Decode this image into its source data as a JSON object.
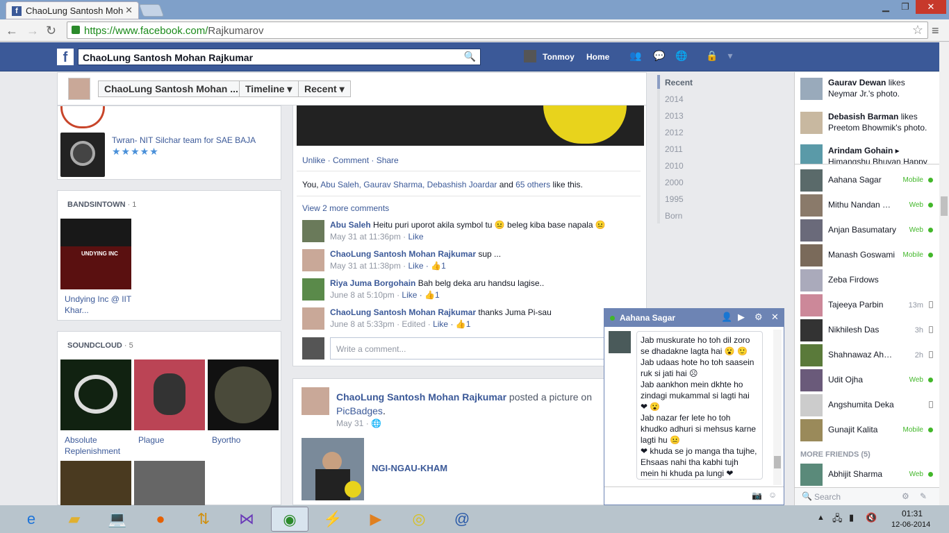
{
  "browser": {
    "tab_title": "ChaoLung Santosh Mohan",
    "url_host": "https://www.facebook.com/",
    "url_path": "Rajkumarov"
  },
  "fb": {
    "search_value": "ChaoLung Santosh Mohan Rajkumar",
    "user_name": "Tonmoy",
    "home_label": "Home"
  },
  "sticky": {
    "name_btn": "ChaoLung Santosh Mohan ...",
    "timeline_btn": "Timeline",
    "recent_btn": "Recent"
  },
  "left": {
    "twran_label": "Twran- NIT Silchar team for SAE BAJA",
    "twran_stars": "★★★★★",
    "bandsintown_header": "BANDSINTOWN",
    "bandsintown_count": "· 1",
    "band_event": "Undying Inc @ IIT Khar...",
    "soundcloud_header": "SOUNDCLOUD",
    "soundcloud_count": "· 5",
    "tracks": [
      "Absolute Replenishment",
      "Plague",
      "Byortho"
    ]
  },
  "post1": {
    "actions": "Unlike · Comment · Share",
    "likes_prefix": "You, ",
    "likes_names": "Abu Saleh, Gaurav Sharma, Debashish Joardar",
    "likes_mid": " and ",
    "likes_others": "65 others",
    "likes_suffix": " like this.",
    "view_more": "View 2 more comments",
    "comments": [
      {
        "name": "Abu Saleh",
        "text": "Heitu puri uporot akila symbol tu 😐 beleg kiba base napala 😐",
        "meta": "May 31 at 11:36pm · ",
        "like": "Like",
        "likes": ""
      },
      {
        "name": "ChaoLung Santosh Mohan Rajkumar",
        "text": "sup ...",
        "meta": "May 31 at 11:38pm · ",
        "like": "Like",
        "likes": " · 👍1"
      },
      {
        "name": "Riya Juma Borgohain",
        "text": "Bah belg deka aru handsu lagise..",
        "meta": "June 8 at 5:10pm · ",
        "like": "Like",
        "likes": " · 👍1"
      },
      {
        "name": "ChaoLung Santosh Mohan Rajkumar",
        "text": "thanks Juma Pi-sau",
        "meta": "June 8 at 5:33pm · Edited · ",
        "like": "Like",
        "likes": " · 👍1"
      }
    ],
    "write_placeholder": "Write a comment..."
  },
  "post2": {
    "author": "ChaoLung Santosh Mohan Rajkumar",
    "action": " posted a picture on ",
    "target": "PicBadges",
    "date": "May 31",
    "caption": "NGI-NGAU-KHAM"
  },
  "years": [
    "Recent",
    "2014",
    "2013",
    "2012",
    "2011",
    "2010",
    "2000",
    "1995",
    "Born"
  ],
  "ticker": [
    {
      "name": "Gaurav Dewan",
      "text": " likes Neymar Jr.'s photo."
    },
    {
      "name": "Debasish Barman",
      "text": " likes Preetom Bhowmik's photo."
    },
    {
      "name": "Arindam Gohain",
      "text": " ▸ Himangshu Bhuyan Happy"
    }
  ],
  "friends": [
    {
      "name": "Aahana Sagar",
      "status": "Mobile"
    },
    {
      "name": "Mithu Nandan Me...",
      "status": "Web"
    },
    {
      "name": "Anjan Basumatary",
      "status": "Web"
    },
    {
      "name": "Manash Goswami",
      "status": "Mobile"
    },
    {
      "name": "Zeba Firdows",
      "status": ""
    },
    {
      "name": "Tajeeya Parbin",
      "status": "13m"
    },
    {
      "name": "Nikhilesh Das",
      "status": "3h"
    },
    {
      "name": "Shahnawaz Ahmed",
      "status": "2h"
    },
    {
      "name": "Udit Ojha",
      "status": "Web"
    },
    {
      "name": "Angshumita Deka",
      "status": ""
    },
    {
      "name": "Gunajit Kalita",
      "status": "Mobile"
    }
  ],
  "more_friends": "MORE FRIENDS (5)",
  "more_friend": {
    "name": "Abhijit Sharma",
    "status": "Web"
  },
  "side_search": "Search",
  "chat": {
    "name": "Aahana Sagar",
    "lines": [
      "Jab muskurate ho toh dil zoro se dhadakne lagta hai 😮 🙂",
      "Jab udaas hote ho toh saasein ruk si jati hai ☹",
      "Jab aankhon mein dkhte ho zindagi mukammal si lagti hai ❤ 😮",
      "Jab nazar fer lete ho toh khudko adhuri si mehsus karne lagti hu 😐",
      "❤ khuda se jo manga tha tujhe, Ehsaas nahi tha kabhi tujh mein hi khuda pa lungi ❤"
    ]
  },
  "taskbar": {
    "time": "01:31",
    "date": "12-06-2014"
  }
}
